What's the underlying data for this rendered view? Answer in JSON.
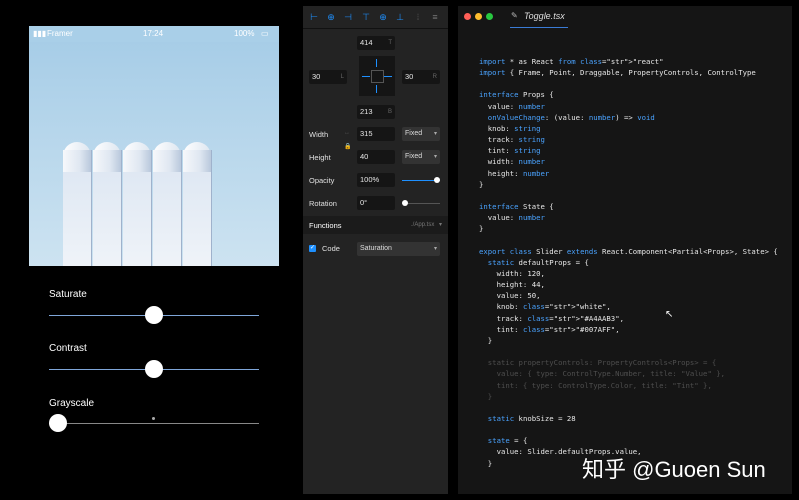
{
  "phone": {
    "carrier": "Framer",
    "time": "17:24",
    "battery": "100%",
    "sliders": [
      {
        "label": "Saturate",
        "value": 0.5
      },
      {
        "label": "Contrast",
        "value": 0.5
      },
      {
        "label": "Grayscale",
        "value": 0.0
      }
    ]
  },
  "props": {
    "top": "414",
    "top_suffix": "T",
    "left": "30",
    "left_suffix": "L",
    "right": "30",
    "right_suffix": "R",
    "bottom": "213",
    "bottom_suffix": "B",
    "width_label": "Width",
    "width_value": "315",
    "width_mode": "Fixed",
    "height_label": "Height",
    "height_value": "40",
    "height_mode": "Fixed",
    "opacity_label": "Opacity",
    "opacity_value": "100%",
    "opacity_level": 1.0,
    "rotation_label": "Rotation",
    "rotation_value": "0°",
    "rotation_level": 0.0,
    "functions_label": "Functions",
    "functions_file": "./App.tsx",
    "code_label": "Code",
    "code_value": "Saturation",
    "accent": "#1e90ff"
  },
  "editor": {
    "tab_title": "Toggle.tsx",
    "file_icon": "pencil-icon",
    "code_lines": [
      "import * as React from \"react\"",
      "import { Frame, Point, Draggable, PropertyControls, ControlType",
      "",
      "interface Props {",
      "  value: number",
      "  onValueChange: (value: number) => void",
      "  knob: string",
      "  track: string",
      "  tint: string",
      "  width: number",
      "  height: number",
      "}",
      "",
      "interface State {",
      "  value: number",
      "}",
      "",
      "export class Slider extends React.Component<Partial<Props>, State> {",
      "  static defaultProps = {",
      "    width: 120,",
      "    height: 44,",
      "    value: 50,",
      "    knob: \"white\",",
      "    track: \"#A4AAB3\",",
      "    tint: \"#007AFF\",",
      "  }",
      "",
      "  static propertyControls: PropertyControls<Props> = {",
      "    value: { type: ControlType.Number, title: \"Value\" },",
      "    tint: { type: ControlType.Color, title: \"Tint\" },",
      "  }",
      "",
      "  static knobSize = 28",
      "",
      "  state = {",
      "    value: Slider.defaultProps.value,",
      "  }"
    ]
  },
  "watermark": "知乎 @Guoen Sun"
}
